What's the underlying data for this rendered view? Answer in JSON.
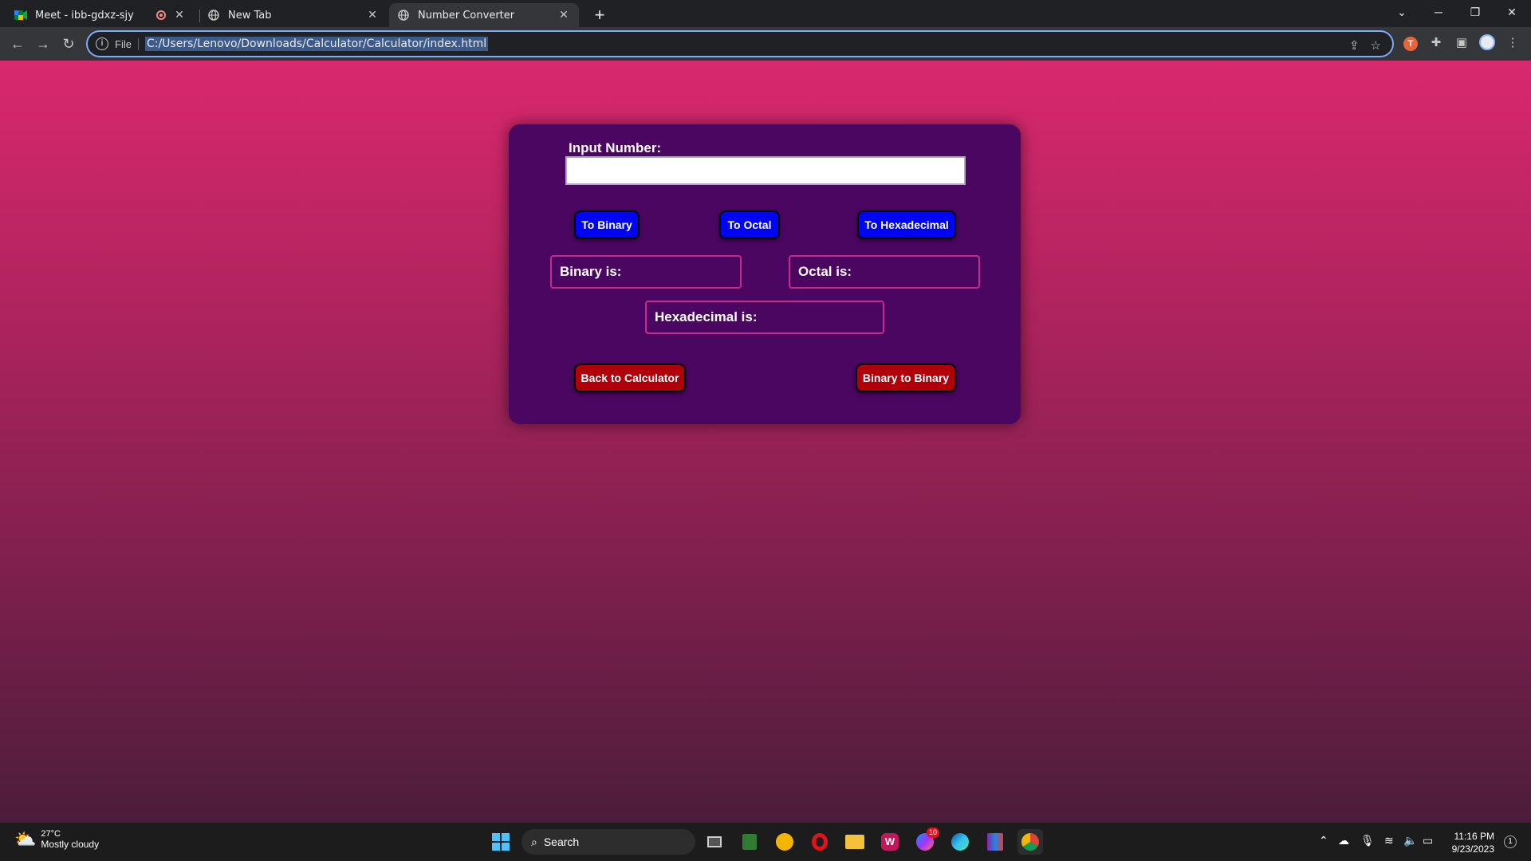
{
  "browser": {
    "tabs": [
      {
        "title": "Meet - ibb-gdxz-sjy",
        "icon": "meet-icon",
        "recording": true
      },
      {
        "title": "New Tab",
        "icon": "globe-icon"
      },
      {
        "title": "Number Converter",
        "icon": "globe-icon",
        "active": true
      }
    ],
    "scheme_label": "File",
    "url": "C:/Users/Lenovo/Downloads/Calculator/Calculator/index.html"
  },
  "page": {
    "input_label": "Input Number:",
    "input_value": "",
    "buttons": {
      "to_binary": "To Binary",
      "to_octal": "To Octal",
      "to_hex": "To Hexadecimal",
      "back": "Back to Calculator",
      "binary_to_binary": "Binary to Binary"
    },
    "results": {
      "binary": "Binary is:",
      "octal": "Octal is:",
      "hex": "Hexadecimal is:"
    },
    "colors": {
      "card": "#4a0661",
      "blue_button": "#0004f5",
      "red_button": "#b0000a",
      "result_border": "#c72a8e"
    }
  },
  "taskbar": {
    "weather_temp": "27°C",
    "weather_cond": "Mostly cloudy",
    "search_label": "Search",
    "messenger_badge": "10",
    "time": "11:16 PM",
    "date": "9/23/2023",
    "notification_count": "1"
  }
}
